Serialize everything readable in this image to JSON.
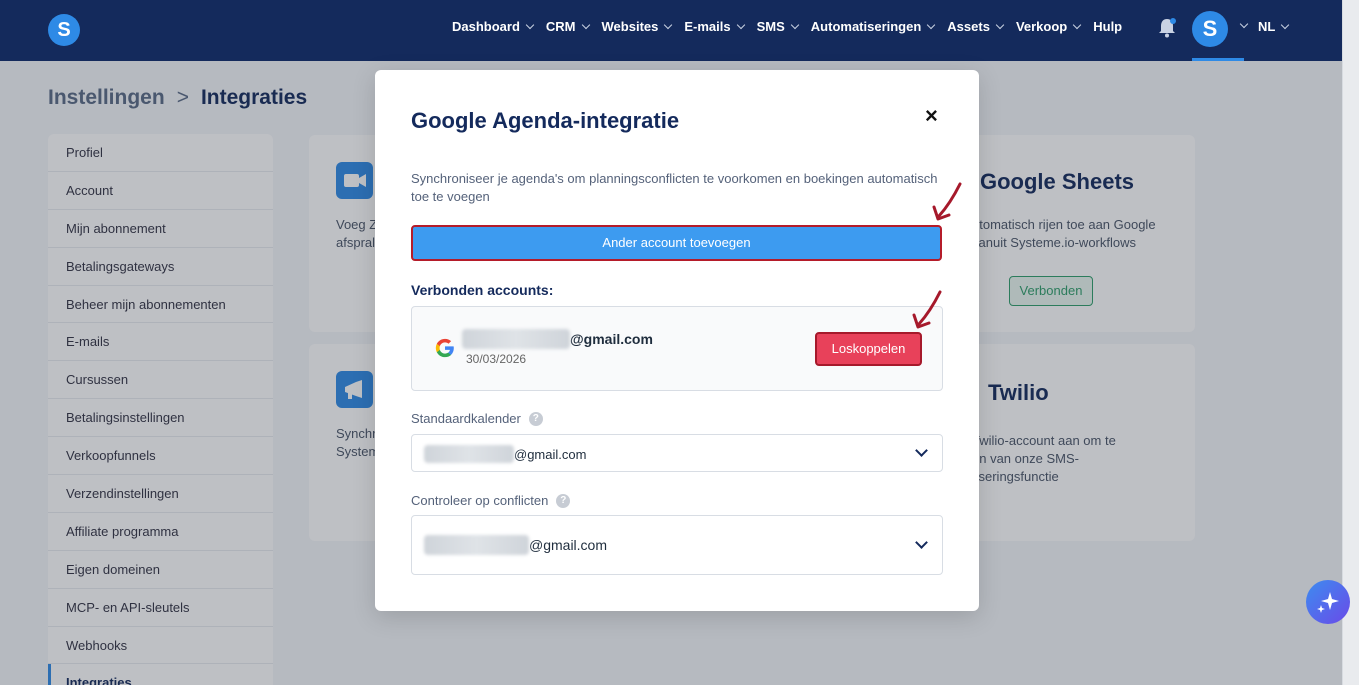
{
  "nav": {
    "items": [
      {
        "label": "Dashboard",
        "dropdown": true
      },
      {
        "label": "CRM",
        "dropdown": true
      },
      {
        "label": "Websites",
        "dropdown": true
      },
      {
        "label": "E-mails",
        "dropdown": true
      },
      {
        "label": "SMS",
        "dropdown": true
      },
      {
        "label": "Automatiseringen",
        "dropdown": true
      },
      {
        "label": "Assets",
        "dropdown": true
      },
      {
        "label": "Verkoop",
        "dropdown": true
      },
      {
        "label": "Hulp",
        "dropdown": false
      }
    ],
    "logo_letter": "S",
    "avatar_letter": "S",
    "language": "NL"
  },
  "breadcrumb": {
    "parent": "Instellingen",
    "separator": ">",
    "current": "Integraties"
  },
  "sidebar": {
    "items": [
      {
        "label": "Profiel"
      },
      {
        "label": "Account"
      },
      {
        "label": "Mijn abonnement"
      },
      {
        "label": "Betalingsgateways"
      },
      {
        "label": "Beheer mijn abonnementen"
      },
      {
        "label": "E-mails"
      },
      {
        "label": "Cursussen"
      },
      {
        "label": "Betalingsinstellingen"
      },
      {
        "label": "Verkoopfunnels"
      },
      {
        "label": "Verzendinstellingen"
      },
      {
        "label": "Affiliate programma"
      },
      {
        "label": "Eigen domeinen"
      },
      {
        "label": "MCP- en API-sleutels"
      },
      {
        "label": "Webhooks"
      },
      {
        "label": "Integraties",
        "active": true
      }
    ]
  },
  "cards": {
    "zoom_text_line1": "Voeg Z",
    "zoom_text_line2": "afspral",
    "webinar_text_line1": "Synchr",
    "webinar_text_line2": "System",
    "sheets_title": "Google Sheets",
    "sheets_text_line1": "utomatisch rijen toe aan Google",
    "sheets_text_line2": "vanuit Systeme.io-workflows",
    "sheets_button": "Verbonden",
    "twilio_title": "Twilio",
    "twilio_text_line1": "Twilio-account aan om te",
    "twilio_text_line2": "en van onze SMS-",
    "twilio_text_line3": "tiseringsfunctie"
  },
  "modal": {
    "title": "Google Agenda-integratie",
    "close_label": "×",
    "description": "Synchroniseer je agenda's om planningsconflicten te voorkomen en boekingen automatisch toe te voegen",
    "add_account_button": "Ander account toevoegen",
    "connected_accounts_label": "Verbonden accounts:",
    "account": {
      "email_suffix": "@gmail.com",
      "date": "30/03/2026",
      "disconnect_button": "Loskoppelen"
    },
    "default_calendar": {
      "label": "Standaardkalender",
      "value_suffix": "@gmail.com"
    },
    "conflict_check": {
      "label": "Controleer op conflicten",
      "value_suffix": "@gmail.com"
    },
    "help_glyph": "?"
  },
  "colors": {
    "nav_bg": "#142a5c",
    "accent": "#2e8ae6",
    "primary_button": "#3d9bf0",
    "danger_button": "#e8415a",
    "annotation": "#a6192b",
    "success": "#2f9e6a"
  },
  "fab_icon": "sparkle-icon"
}
